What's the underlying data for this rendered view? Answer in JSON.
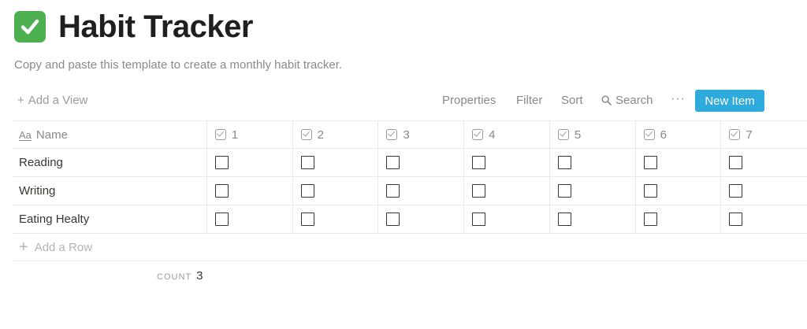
{
  "page": {
    "title": "Habit Tracker",
    "title_icon": "check-mark-button-icon",
    "description": "Copy and paste this template to create a monthly habit tracker."
  },
  "toolbar": {
    "add_view_label": "Add a View",
    "properties_label": "Properties",
    "filter_label": "Filter",
    "sort_label": "Sort",
    "search_label": "Search",
    "more_label": "···",
    "new_item_label": "New Item",
    "accent_color": "#2eaadc"
  },
  "table": {
    "name_header": "Name",
    "day_headers": [
      "1",
      "2",
      "3",
      "4",
      "5",
      "6",
      "7"
    ],
    "rows": [
      {
        "name": "Reading",
        "checks": [
          false,
          false,
          false,
          false,
          false,
          false,
          false
        ]
      },
      {
        "name": "Writing",
        "checks": [
          false,
          false,
          false,
          false,
          false,
          false,
          false
        ]
      },
      {
        "name": "Eating Healty",
        "checks": [
          false,
          false,
          false,
          false,
          false,
          false,
          false
        ]
      }
    ],
    "add_row_label": "Add a Row",
    "count_label": "COUNT",
    "count_value": "3"
  }
}
